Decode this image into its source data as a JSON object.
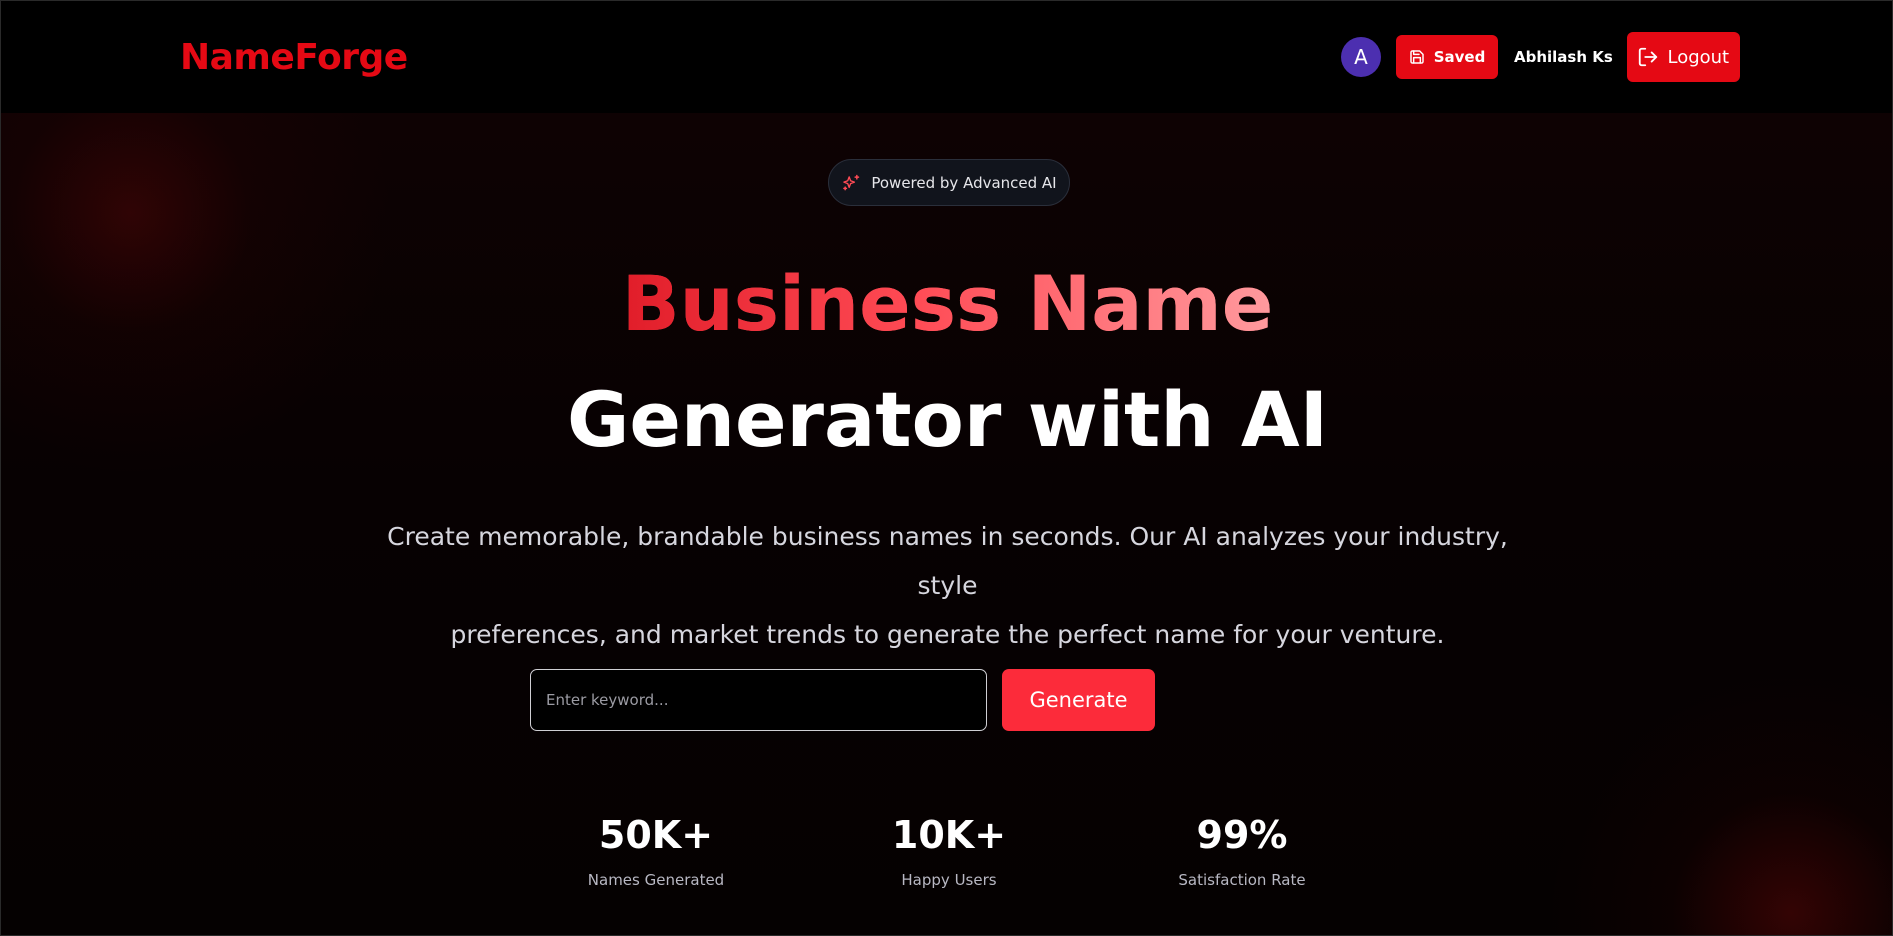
{
  "brand": {
    "name": "NameForge",
    "accent_color": "#e50914"
  },
  "nav": {
    "avatar_letter": "A",
    "saved_label": "Saved",
    "saved_icon": "save-icon",
    "user_name": "Abhilash Ks",
    "logout_label": "Logout",
    "logout_icon": "logout-icon"
  },
  "hero": {
    "badge_text": "Powered by Advanced AI",
    "badge_icon": "sparkles-icon",
    "title_line1": "Business Name",
    "title_line2": "Generator with AI",
    "description_line1": "Create memorable, brandable business names in seconds. Our AI analyzes your industry, style",
    "description_line2": "preferences, and market trends to generate the perfect name for your venture."
  },
  "search": {
    "placeholder": "Enter keyword...",
    "value": "",
    "button_label": "Generate"
  },
  "stats": [
    {
      "value": "50K+",
      "label": "Names Generated"
    },
    {
      "value": "10K+",
      "label": "Happy Users"
    },
    {
      "value": "99%",
      "label": "Satisfaction Rate"
    }
  ]
}
